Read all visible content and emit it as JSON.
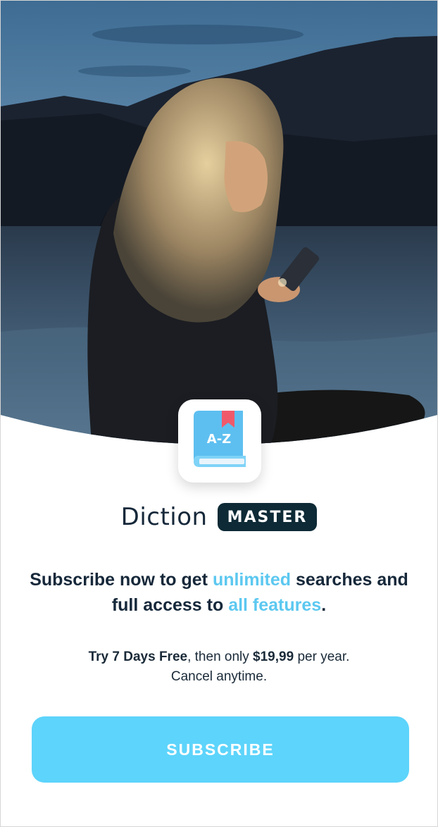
{
  "hero": {
    "image_icon": "woman-using-phone-at-dusk-photo"
  },
  "app_icon": {
    "name": "dictionary-book-icon",
    "label": "A-Z"
  },
  "brand": {
    "name": "Diction",
    "badge": "MASTER"
  },
  "headline": {
    "part1": "Subscribe now to get ",
    "highlight1": "unlimited",
    "part2": " searches and full access to ",
    "highlight2": "all features",
    "part3": "."
  },
  "offer": {
    "trial": "Try 7 Days Free",
    "middle": ", then only ",
    "price": "$19,99",
    "period": " per year.",
    "cancel": "Cancel anytime."
  },
  "subscribe_button": {
    "label": "SUBSCRIBE"
  },
  "colors": {
    "accent": "#5dd4fb",
    "highlight": "#5cc8f0",
    "dark": "#0d2a36"
  }
}
